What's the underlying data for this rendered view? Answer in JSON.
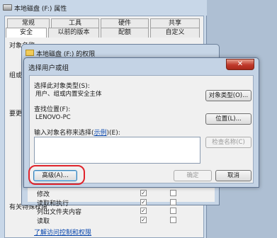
{
  "props_window": {
    "title": "本地磁盘 (F:) 属性",
    "tabs_row1": [
      "常规",
      "工具",
      "硬件",
      "共享"
    ],
    "tabs_row2": [
      "安全",
      "以前的版本",
      "配额",
      "自定义"
    ],
    "left_fragments": [
      "对象名称:",
      "组或用户名",
      "要更改权限",
      "有关特殊权限",
      "修改",
      "读取"
    ]
  },
  "perm_window": {
    "title": "本地磁盘 (F:) 的权限",
    "permissions": [
      {
        "label": "修改",
        "allow": true,
        "deny": false
      },
      {
        "label": "读取和执行",
        "allow": true,
        "deny": false
      },
      {
        "label": "列出文件夹内容",
        "allow": true,
        "deny": false
      },
      {
        "label": "读取",
        "allow": true,
        "deny": false
      }
    ],
    "help_link": "了解访问控制和权限"
  },
  "dialog": {
    "title": "选择用户或组",
    "close_glyph": "✕",
    "object_type_label": "选择此对象类型(S):",
    "object_type_value": "用户、组或内置安全主体",
    "object_type_button": "对象类型(O)...",
    "location_label": "查找位置(F):",
    "location_value": "LENOVO-PC",
    "location_button": "位置(L)...",
    "enter_label_pre": "输入对象名称来选择(",
    "enter_label_link": "示例",
    "enter_label_post": ")(E):",
    "check_names_button": "检查名称(C)",
    "advanced_button": "高级(A)...",
    "ok_button": "确定",
    "cancel_button": "取消"
  }
}
